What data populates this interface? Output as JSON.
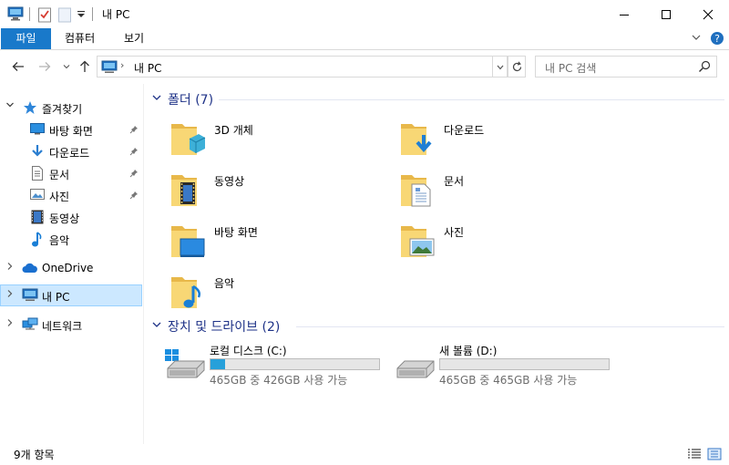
{
  "window": {
    "title": "내 PC",
    "minimize_glyph": "—",
    "maximize_glyph": "☐",
    "close_glyph": "✕"
  },
  "ribbon": {
    "tabs": [
      {
        "label": "파일",
        "active": true
      },
      {
        "label": "컴퓨터",
        "active": false
      },
      {
        "label": "보기",
        "active": false
      }
    ],
    "expand_glyph": "∨",
    "help_glyph": "?"
  },
  "address": {
    "path": "내 PC",
    "chevron": "›",
    "dropdown_glyph": "∨",
    "refresh_glyph": "↻"
  },
  "search": {
    "placeholder": "내 PC 검색"
  },
  "nav": {
    "quick_access": "즐겨찾기",
    "pinned": [
      {
        "label": "바탕 화면",
        "icon": "desktop-icon",
        "pinned": true
      },
      {
        "label": "다운로드",
        "icon": "download-icon",
        "pinned": true
      },
      {
        "label": "문서",
        "icon": "document-icon",
        "pinned": true
      },
      {
        "label": "사진",
        "icon": "picture-icon",
        "pinned": true
      },
      {
        "label": "동영상",
        "icon": "video-icon",
        "pinned": false
      },
      {
        "label": "음악",
        "icon": "music-icon",
        "pinned": false
      }
    ],
    "onedrive": "OneDrive",
    "thispc": "내 PC",
    "network": "네트워크"
  },
  "folders": {
    "header": "폴더 (7)",
    "items": [
      {
        "label": "3D 개체",
        "icon": "3d-objects-folder-icon"
      },
      {
        "label": "다운로드",
        "icon": "downloads-folder-icon"
      },
      {
        "label": "동영상",
        "icon": "videos-folder-icon"
      },
      {
        "label": "문서",
        "icon": "documents-folder-icon"
      },
      {
        "label": "바탕 화면",
        "icon": "desktop-folder-icon"
      },
      {
        "label": "사진",
        "icon": "pictures-folder-icon"
      },
      {
        "label": "음악",
        "icon": "music-folder-icon"
      }
    ]
  },
  "drives": {
    "header": "장치 및 드라이브 (2)",
    "items": [
      {
        "name": "로컬 디스크 (C:)",
        "free": "465GB 중 426GB 사용 가능",
        "used_fraction": 0.084,
        "system": true
      },
      {
        "name": "새 볼륨 (D:)",
        "free": "465GB 중 465GB 사용 가능",
        "used_fraction": 0.0,
        "system": false
      }
    ]
  },
  "status": {
    "item_count": "9개 항목"
  },
  "colors": {
    "accent": "#1979ca",
    "selection": "#cce8ff",
    "group_header": "#1e3287",
    "drive_fill": "#26a0da",
    "folder": "#f8d775"
  }
}
